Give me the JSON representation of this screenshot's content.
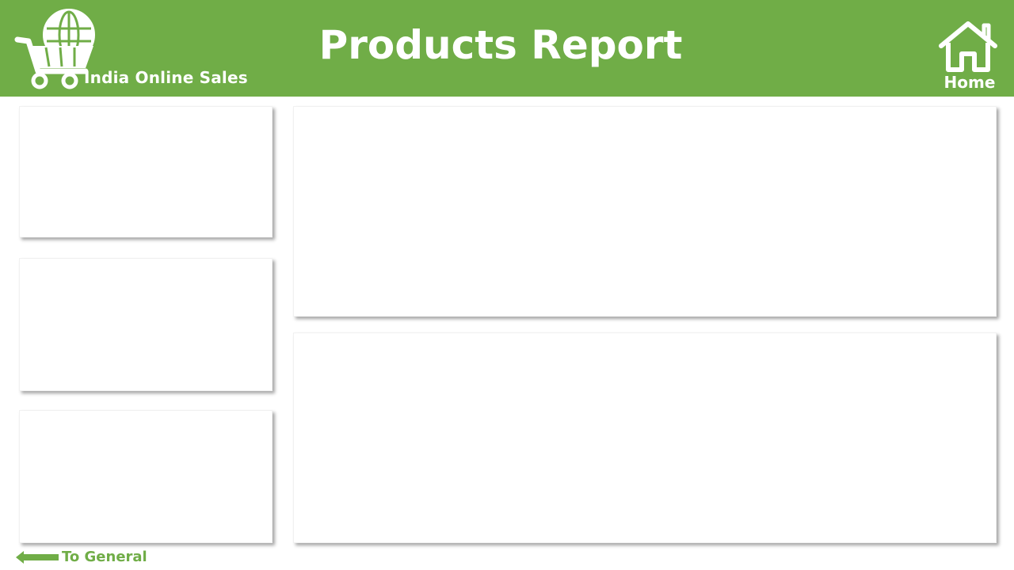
{
  "header": {
    "brand_name": "India Online Sales",
    "title": "Products Report",
    "home_label": "Home",
    "logo_icon": "shopping-cart-globe-icon",
    "home_icon": "house-icon",
    "background_color": "#70ad47",
    "text_color": "#ffffff"
  },
  "footer": {
    "back_label": "To General",
    "back_icon": "left-arrow-icon",
    "color": "#70ad47"
  }
}
